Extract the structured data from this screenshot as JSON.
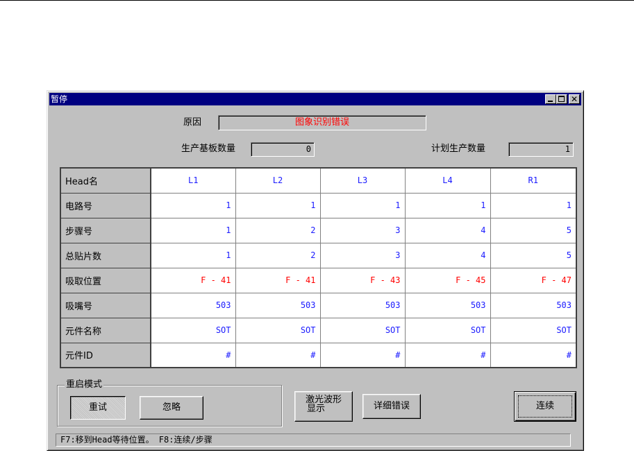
{
  "window": {
    "title": "暂停"
  },
  "reason": {
    "label": "原因",
    "value": "图象识别错误"
  },
  "production": {
    "board_count_label": "生产基板数量",
    "board_count_value": "0",
    "planned_count_label": "计划生产数量",
    "planned_count_value": "1"
  },
  "table": {
    "corner_header": "Head名",
    "columns": [
      "L1",
      "L2",
      "L3",
      "L4",
      "R1"
    ],
    "rows": [
      {
        "label": "电路号",
        "values": [
          "1",
          "1",
          "1",
          "1",
          "1"
        ]
      },
      {
        "label": "步骤号",
        "values": [
          "1",
          "2",
          "3",
          "4",
          "5"
        ]
      },
      {
        "label": "总贴片数",
        "values": [
          "1",
          "2",
          "3",
          "4",
          "5"
        ]
      },
      {
        "label": "吸取位置",
        "values": [
          "F - 41",
          "F - 41",
          "F - 43",
          "F - 45",
          "F - 47"
        ]
      },
      {
        "label": "吸嘴号",
        "values": [
          "503",
          "503",
          "503",
          "503",
          "503"
        ]
      },
      {
        "label": "元件名称",
        "values": [
          "SOT",
          "SOT",
          "SOT",
          "SOT",
          "SOT"
        ]
      },
      {
        "label": "元件ID",
        "values": [
          "#",
          "#",
          "#",
          "#",
          "#"
        ]
      }
    ]
  },
  "restart_mode": {
    "legend": "重启模式",
    "retry_label": "重试",
    "ignore_label": "忽略"
  },
  "buttons": {
    "laser_waveform_label_line1": "激光波形",
    "laser_waveform_label_line2": "显示",
    "detail_error_label": "详细错误",
    "continue_label": "连续"
  },
  "status": {
    "text": "F7:移到Head等待位置。  F8:连续/步骤"
  },
  "colors": {
    "titlebar": "#000080",
    "value_blue": "#1a1aff",
    "alert_red": "#ff0000",
    "face": "#c0c0c0"
  }
}
